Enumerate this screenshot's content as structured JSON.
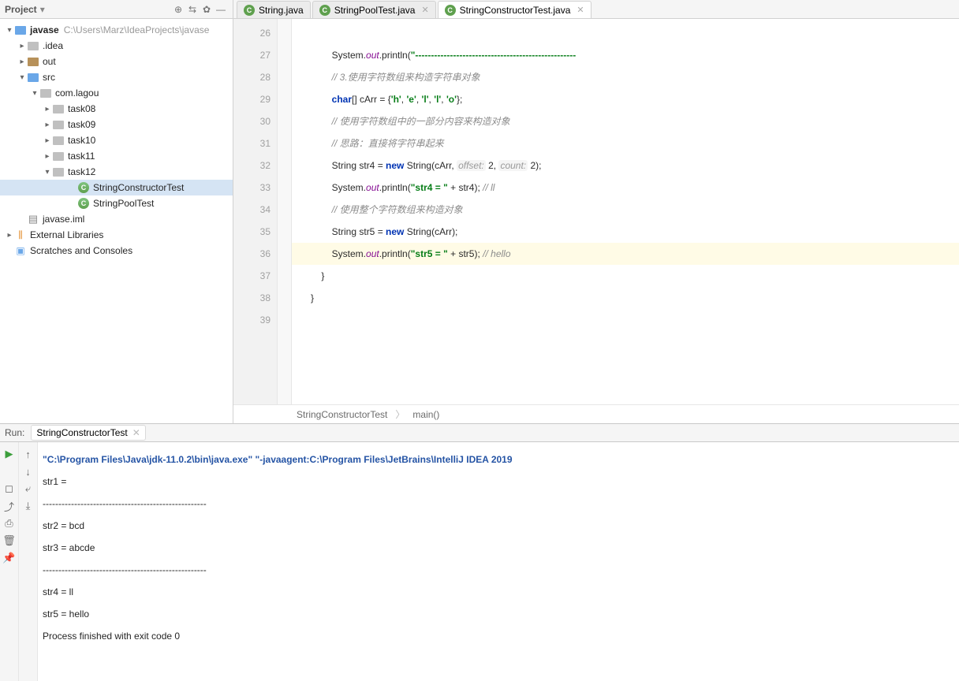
{
  "sidebar": {
    "title": "Project",
    "root": {
      "name": "javase",
      "path": "C:\\Users\\Marz\\IdeaProjects\\javase"
    },
    "idea": ".idea",
    "out": "out",
    "src": "src",
    "pkg": "com.lagou",
    "tasks": [
      "task08",
      "task09",
      "task10",
      "task11",
      "task12"
    ],
    "files": [
      "StringConstructorTest",
      "StringPoolTest"
    ],
    "iml": "javase.iml",
    "ext": "External Libraries",
    "scratch": "Scratches and Consoles"
  },
  "tabs": [
    {
      "label": "String.java"
    },
    {
      "label": "StringPoolTest.java"
    },
    {
      "label": "StringConstructorTest.java"
    }
  ],
  "code": {
    "start": 26,
    "lines": [
      "",
      "        System.<fld>out</fld>.println(<s>\"---------------------------------------------------</s>",
      "        <c>// 3.使用字符数组来构造字符串对象</c>",
      "        <k>char</k>[] cArr = {<s>'h'</s>, <s>'e'</s>, <s>'l'</s>, <s>'l'</s>, <s>'o'</s>};",
      "        <c>// 使用字符数组中的一部分内容来构造对象</c>",
      "        <c>// 思路：直接将字符串起来</c>",
      "        String str4 = <k>new</k> String(cArr, <hint>offset:</hint> 2, <hint>count:</hint> 2);",
      "        System.<fld>out</fld>.println(<s>\"str4 = \"</s> + str4); <c>// ll</c>",
      "        <c>// 使用整个字符数组来构造对象</c>",
      "        String str5 = <k>new</k> String(cArr);",
      "        System.<fld>out</fld>.println(<s>\"str5 = \"</s> + str5); <c>// hello</c>",
      "    }",
      "}",
      ""
    ],
    "hl": 10
  },
  "crumb": {
    "a": "StringConstructorTest",
    "b": "main()"
  },
  "run": {
    "label": "Run:",
    "tab": "StringConstructorTest",
    "out": [
      {
        "t": "cmd",
        "v": "\"C:\\Program Files\\Java\\jdk-11.0.2\\bin\\java.exe\" \"-javaagent:C:\\Program Files\\JetBrains\\IntelliJ IDEA 2019"
      },
      {
        "t": "",
        "v": "str1 = "
      },
      {
        "t": "",
        "v": "----------------------------------------------------"
      },
      {
        "t": "",
        "v": "str2 = bcd"
      },
      {
        "t": "",
        "v": "str3 = abcde"
      },
      {
        "t": "",
        "v": "----------------------------------------------------"
      },
      {
        "t": "",
        "v": "str4 = ll"
      },
      {
        "t": "",
        "v": "str5 = hello"
      },
      {
        "t": "",
        "v": ""
      },
      {
        "t": "",
        "v": "Process finished with exit code 0"
      }
    ]
  }
}
